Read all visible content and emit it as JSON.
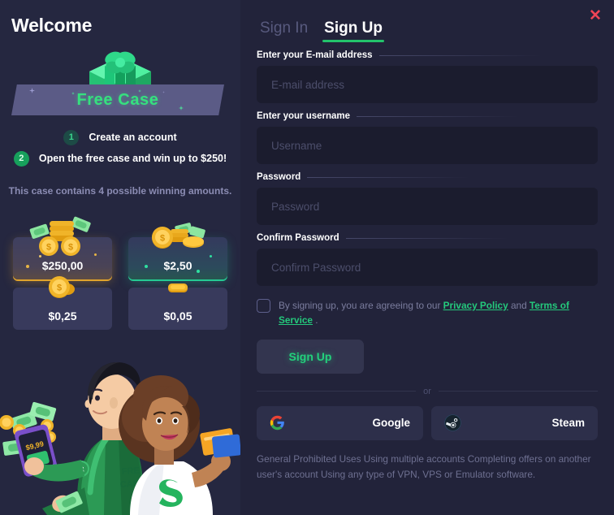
{
  "modal": {
    "close_icon": "close-icon",
    "close_glyph": "✕"
  },
  "left": {
    "welcome_title": "Welcome",
    "gift_icon": "gift-box-icon",
    "ribbon_label": "Free Case",
    "steps": [
      {
        "number": "1",
        "label": "Create an account"
      },
      {
        "number": "2",
        "label": "Open the free case and win up to $250!"
      }
    ],
    "contains_note": "This case contains 4 possible winning amounts.",
    "prizes": [
      {
        "value": "$250,00",
        "art": "coins-stack-bills-icon",
        "highlight": "gold"
      },
      {
        "value": "$2,50",
        "art": "coins-bills-icon",
        "highlight": "teal"
      },
      {
        "value": "$0,25",
        "art": "single-coin-icon",
        "highlight": "none"
      },
      {
        "value": "$0,05",
        "art": "coin-edge-icon",
        "highlight": "none"
      }
    ],
    "illustration": "two-characters-with-money-illustration"
  },
  "right": {
    "tabs": [
      {
        "label": "Sign In",
        "active": false
      },
      {
        "label": "Sign Up",
        "active": true
      }
    ],
    "fields": [
      {
        "label": "Enter your E-mail address",
        "placeholder": "E-mail address",
        "value": "",
        "type": "email",
        "name": "email-field"
      },
      {
        "label": "Enter your username",
        "placeholder": "Username",
        "value": "",
        "type": "text",
        "name": "username-field"
      },
      {
        "label": "Password",
        "placeholder": "Password",
        "value": "",
        "type": "password",
        "name": "password-field"
      },
      {
        "label": "Confirm Password",
        "placeholder": "Confirm Password",
        "value": "",
        "type": "password",
        "name": "confirm-password-field"
      }
    ],
    "terms": {
      "checked": false,
      "prefix": "By signing up, you are agreeing to our ",
      "link_privacy": "Privacy Policy",
      "between": " and ",
      "link_terms": "Terms of Service",
      "suffix": " ."
    },
    "submit_label": "Sign Up",
    "or_label": "or",
    "social": [
      {
        "label": "Google",
        "icon": "google-icon"
      },
      {
        "label": "Steam",
        "icon": "steam-icon"
      }
    ],
    "disclaimer": "General Prohibited Uses Using multiple accounts Completing offers on another user's account Using any type of VPN, VPS or Emulator software."
  },
  "colors": {
    "accent_green": "#23c36b",
    "link_green": "#24c97c",
    "close_red": "#ef4456",
    "panel_bg": "#22233a",
    "left_bg": "#252740",
    "input_bg": "#1b1c2e",
    "card_bg": "#383a5c",
    "ribbon_bg": "#5b5b86",
    "gold": "#e0a32c",
    "teal": "#25c993"
  }
}
